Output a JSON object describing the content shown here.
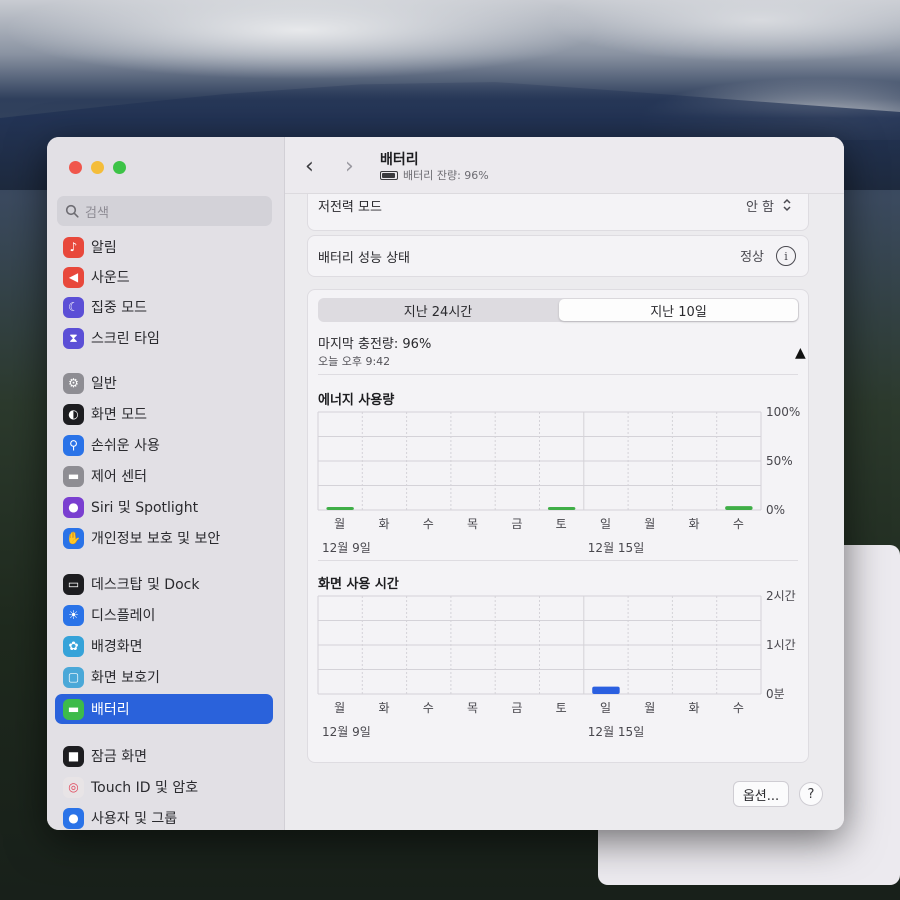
{
  "window": {
    "title": "배터리",
    "subtitle": "배터리 잔량: 96%",
    "back_icon": "chevron-left-icon",
    "forward_icon": "chevron-right-icon"
  },
  "sidebar": {
    "search_placeholder": "검색",
    "items": [
      {
        "label": "알림",
        "icon": "bell-icon",
        "color": "#e8483b"
      },
      {
        "label": "사운드",
        "icon": "speaker-icon",
        "color": "#e8483b"
      },
      {
        "label": "집중 모드",
        "icon": "moon-icon",
        "color": "#5b4fd6"
      },
      {
        "label": "스크린 타임",
        "icon": "hourglass-icon",
        "color": "#5b4fd6"
      },
      {
        "label": "일반",
        "icon": "gear-icon",
        "color": "#8e8d93"
      },
      {
        "label": "화면 모드",
        "icon": "appearance-icon",
        "color": "#1d1d20"
      },
      {
        "label": "손쉬운 사용",
        "icon": "accessibility-icon",
        "color": "#2a73e8"
      },
      {
        "label": "제어 센터",
        "icon": "toggles-icon",
        "color": "#8e8d93"
      },
      {
        "label": "Siri 및 Spotlight",
        "icon": "siri-icon",
        "color": "#7a3fd0"
      },
      {
        "label": "개인정보 보호 및 보안",
        "icon": "hand-icon",
        "color": "#2a73e8"
      },
      {
        "label": "데스크탑 및 Dock",
        "icon": "dock-icon",
        "color": "#1d1d20"
      },
      {
        "label": "디스플레이",
        "icon": "sun-icon",
        "color": "#2a73e8"
      },
      {
        "label": "배경화면",
        "icon": "flower-icon",
        "color": "#36a3d9"
      },
      {
        "label": "화면 보호기",
        "icon": "screensaver-icon",
        "color": "#4aa8d8"
      },
      {
        "label": "배터리",
        "icon": "battery-icon",
        "color": "#3dbb4a",
        "active": true
      },
      {
        "label": "잠금 화면",
        "icon": "lock-icon",
        "color": "#1d1d20"
      },
      {
        "label": "Touch ID 및 암호",
        "icon": "fingerprint-icon",
        "color": "#e8e4e6"
      },
      {
        "label": "사용자 및 그룹",
        "icon": "users-icon",
        "color": "#2a73e8"
      }
    ]
  },
  "settings": {
    "low_power_label": "저전력 모드",
    "low_power_value": "안 함",
    "health_label": "배터리 성능 상태",
    "health_value": "정상"
  },
  "usage": {
    "tabs": [
      "지난 24시간",
      "지난 10일"
    ],
    "active_tab": 1,
    "last_charge": "마지막 충전량: 96%",
    "last_charge_time": "오늘 오후 9:42"
  },
  "chart_data": [
    {
      "type": "bar",
      "title": "에너지 사용량",
      "categories": [
        "월",
        "화",
        "수",
        "목",
        "금",
        "토",
        "일",
        "월",
        "화",
        "수"
      ],
      "date_labels": [
        "12월 9일",
        "12월 15일"
      ],
      "y_ticks": [
        "100%",
        "50%",
        "0%"
      ],
      "ylim": [
        0,
        100
      ],
      "values": [
        1,
        0,
        0,
        0,
        0,
        1,
        0,
        0,
        0,
        4
      ],
      "color": "#3fae47"
    },
    {
      "type": "bar",
      "title": "화면 사용 시간",
      "categories": [
        "월",
        "화",
        "수",
        "목",
        "금",
        "토",
        "일",
        "월",
        "화",
        "수"
      ],
      "date_labels": [
        "12월 9일",
        "12월 15일"
      ],
      "y_ticks": [
        "2시간",
        "1시간",
        "0분"
      ],
      "ylim": [
        0,
        2
      ],
      "values": [
        0,
        0,
        0,
        0,
        0,
        0,
        0.15,
        0,
        0,
        0
      ],
      "color": "#2a5fe0"
    }
  ],
  "footer": {
    "options_label": "옵션...",
    "help_label": "?"
  }
}
